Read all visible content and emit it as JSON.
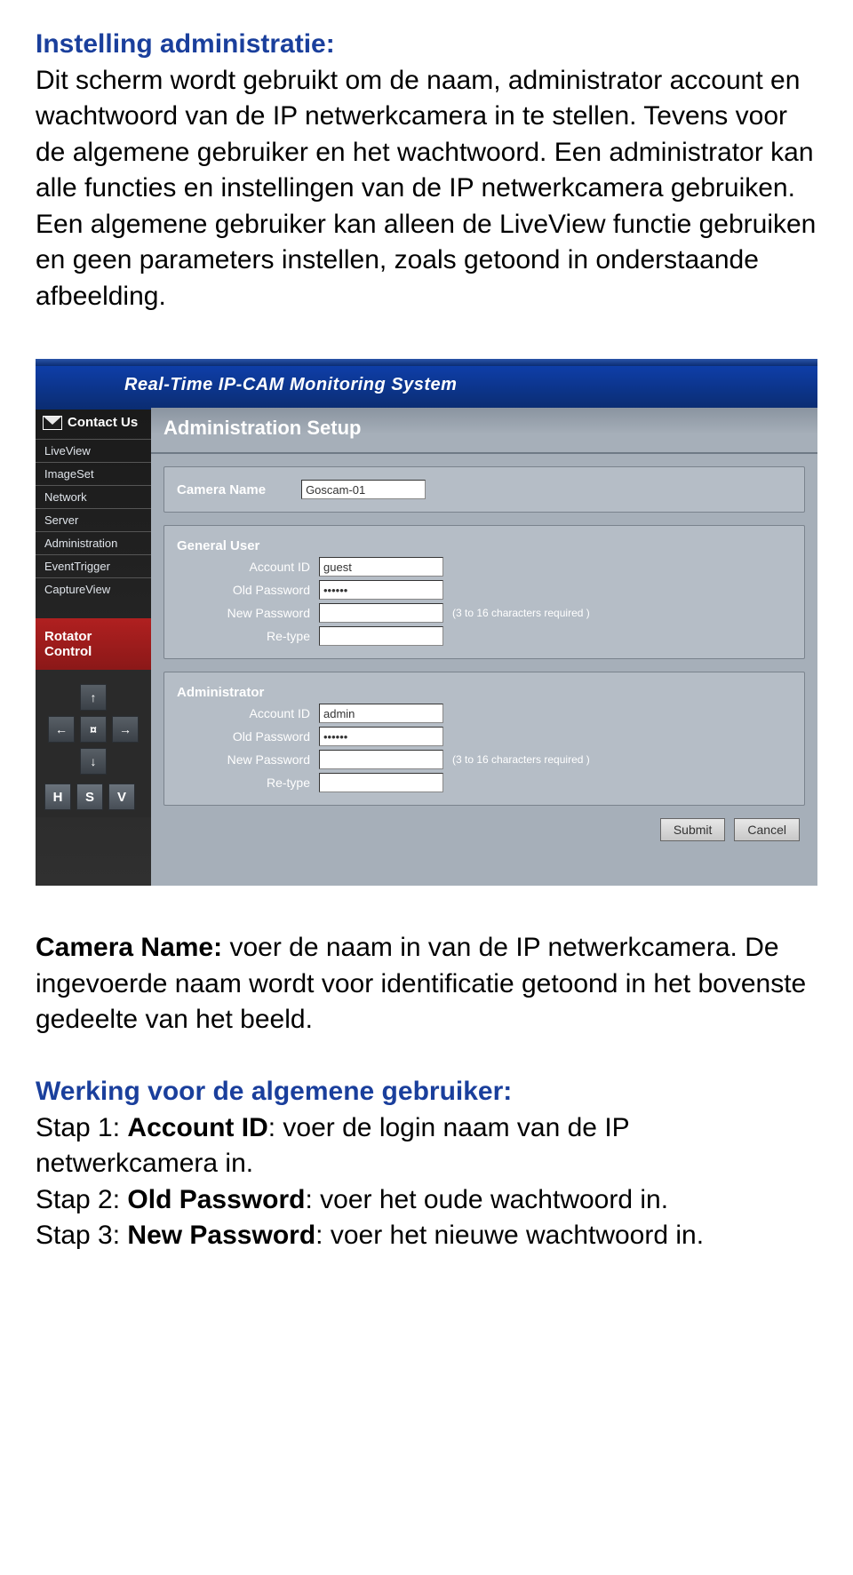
{
  "intro": {
    "heading": "Instelling administratie:",
    "body": "Dit scherm wordt gebruikt om de naam, administrator account en wachtwoord van de IP netwerkcamera in te stellen. Tevens voor de algemene gebruiker en het wachtwoord. Een administrator kan alle functies en instellingen van de IP netwerkcamera gebruiken. Een algemene gebruiker kan alleen de LiveView functie gebruiken en geen parameters instellen, zoals getoond in onderstaande afbeelding."
  },
  "app": {
    "title": "Real-Time IP-CAM Monitoring System",
    "contact": "Contact Us",
    "nav": [
      "LiveView",
      "ImageSet",
      "Network",
      "Server",
      "Administration",
      "EventTrigger",
      "CaptureView"
    ],
    "rotator": "Rotator Control",
    "dpad": {
      "up": "↑",
      "left": "←",
      "center": "¤",
      "right": "→",
      "down": "↓"
    },
    "hsv": [
      "H",
      "S",
      "V"
    ],
    "pageTitle": "Administration Setup",
    "cameraName": {
      "label": "Camera Name",
      "value": "Goscam-01"
    },
    "generalUser": {
      "heading": "General User",
      "accountId": {
        "label": "Account ID",
        "value": "guest"
      },
      "oldPassword": {
        "label": "Old Password",
        "value": "••••••"
      },
      "newPassword": {
        "label": "New Password",
        "value": "",
        "hint": "(3 to 16 characters required )"
      },
      "retype": {
        "label": "Re-type",
        "value": ""
      }
    },
    "administrator": {
      "heading": "Administrator",
      "accountId": {
        "label": "Account ID",
        "value": "admin"
      },
      "oldPassword": {
        "label": "Old Password",
        "value": "••••••"
      },
      "newPassword": {
        "label": "New Password",
        "value": "",
        "hint": "(3 to 16 characters required )"
      },
      "retype": {
        "label": "Re-type",
        "value": ""
      }
    },
    "buttons": {
      "submit": "Submit",
      "cancel": "Cancel"
    }
  },
  "outro": {
    "cameraName": {
      "label": "Camera Name:",
      "text": " voer de naam in van de IP netwerkcamera. De ingevoerde naam wordt voor identificatie getoond in het bovenste gedeelte van het beeld."
    },
    "generalHeading": "Werking voor de algemene gebruiker:",
    "step1a": "Stap 1: ",
    "step1b": "Account ID",
    "step1c": ": voer de login naam van de IP netwerkcamera in.",
    "step2a": "Stap 2: ",
    "step2b": "Old Password",
    "step2c": ": voer het oude wachtwoord in.",
    "step3a": "Stap 3: ",
    "step3b": "New Password",
    "step3c": ": voer het nieuwe wachtwoord in."
  }
}
